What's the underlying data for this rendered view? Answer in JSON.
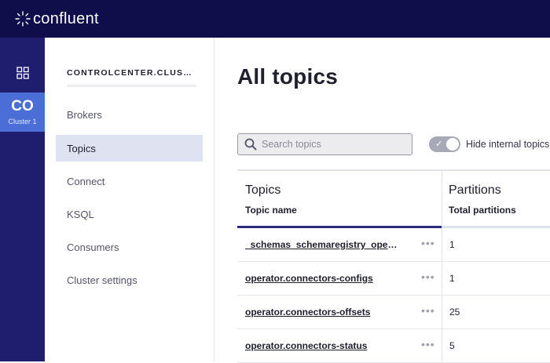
{
  "app": {
    "logo_text": "confluent"
  },
  "rail": {
    "cluster_abbr": "CO",
    "cluster_label": "Cluster 1"
  },
  "sidenav": {
    "cluster_name": "CONTROLCENTER.CLUSTER",
    "items": [
      {
        "label": "Brokers",
        "active": false
      },
      {
        "label": "Topics",
        "active": true
      },
      {
        "label": "Connect",
        "active": false
      },
      {
        "label": "KSQL",
        "active": false
      },
      {
        "label": "Consumers",
        "active": false
      },
      {
        "label": "Cluster settings",
        "active": false
      }
    ]
  },
  "main": {
    "title": "All topics",
    "search": {
      "placeholder": "Search topics",
      "value": ""
    },
    "toggle": {
      "label": "Hide internal topics",
      "checked": true
    }
  },
  "table": {
    "columns": [
      {
        "title": "Topics",
        "subtitle": "Topic name"
      },
      {
        "title": "Partitions",
        "subtitle": "Total partitions"
      }
    ],
    "rows": [
      {
        "name": "_schemas_schemaregistry_operator",
        "partitions": "1"
      },
      {
        "name": "operator.connectors-configs",
        "partitions": "1"
      },
      {
        "name": "operator.connectors-offsets",
        "partitions": "25"
      },
      {
        "name": "operator.connectors-status",
        "partitions": "5"
      }
    ]
  },
  "colors": {
    "topbar": "#0f0d4a",
    "rail": "#1f1d6e",
    "cluster_tile": "#4b6ed6",
    "active_nav": "#dfe2f1",
    "header_rule": "#2c2a80"
  }
}
